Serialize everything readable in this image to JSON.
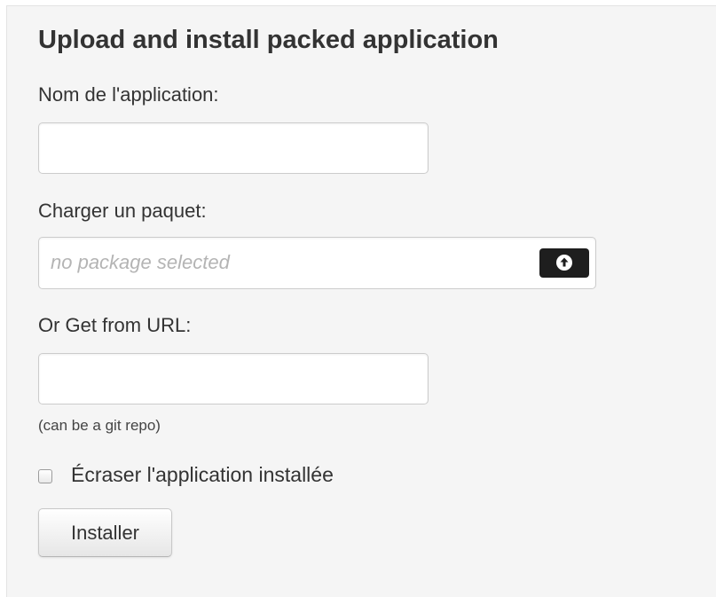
{
  "form": {
    "title": "Upload and install packed application",
    "app_name": {
      "label": "Nom de l'application:",
      "value": ""
    },
    "package": {
      "label": "Charger un paquet:",
      "placeholder": "no package selected",
      "button_icon": "upload-icon"
    },
    "url": {
      "label": "Or Get from URL:",
      "value": "",
      "hint": "(can be a git repo)"
    },
    "overwrite": {
      "label": "Écraser l'application installée",
      "checked": false
    },
    "submit_label": "Installer"
  },
  "colors": {
    "panel_bg": "#f5f5f5",
    "upload_button_bg": "#1e1e1e",
    "placeholder_text": "#b4b4b4"
  }
}
